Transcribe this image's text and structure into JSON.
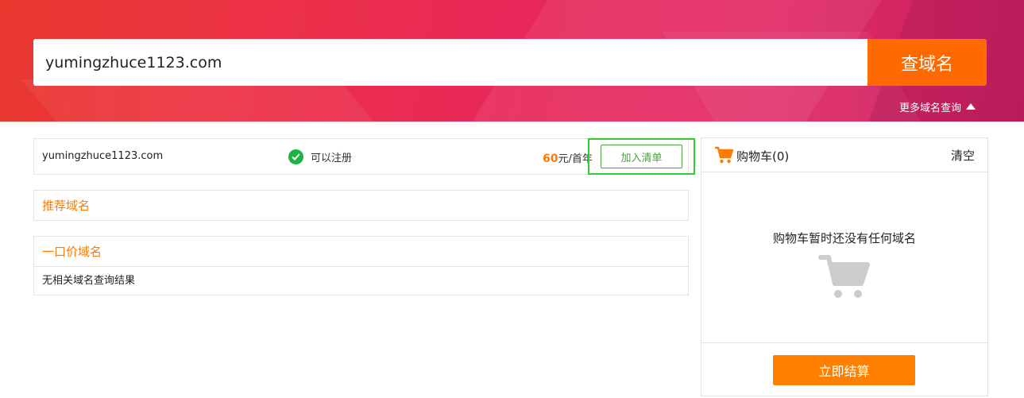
{
  "header": {
    "search_value": "yumingzhuce1123.com",
    "search_button": "查域名",
    "more_link": "更多域名查询",
    "colors": {
      "banner_start": "#e8382e",
      "banner_end": "#c71d5e",
      "button": "#ff6a00"
    }
  },
  "result": {
    "domain": "yumingzhuce1123.com",
    "status": "可以注册",
    "price_value": "60",
    "price_unit": "元/首年",
    "add_button": "加入清单"
  },
  "sections": {
    "recommend_title": "推荐域名",
    "fixed_price_title": "一口价域名",
    "fixed_price_empty": "无相关域名查询结果"
  },
  "cart": {
    "title": "购物车(0)",
    "clear": "清空",
    "empty_text": "购物车暂时还没有任何域名",
    "checkout_button": "立即结算",
    "accent": "#ff8000"
  }
}
